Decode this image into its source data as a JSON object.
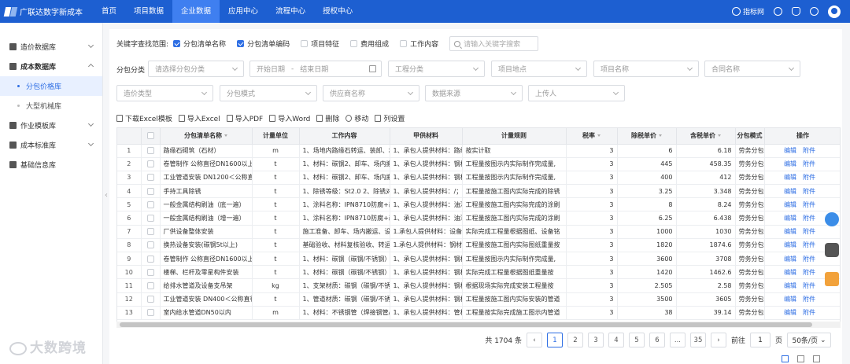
{
  "app": {
    "title": "广联达数字新成本"
  },
  "nav": [
    "首页",
    "项目数据",
    "企业数据",
    "应用中心",
    "流程中心",
    "授权中心"
  ],
  "nav_active_index": 2,
  "header_right": {
    "index_net": "指标网"
  },
  "sidebar": {
    "items": [
      {
        "label": "造价数据库"
      },
      {
        "label": "成本数据库"
      },
      {
        "label": "分包价格库"
      },
      {
        "label": "大型机械库"
      },
      {
        "label": "作业模板库"
      },
      {
        "label": "成本标准库"
      },
      {
        "label": "基础信息库"
      }
    ]
  },
  "keyword_filter": {
    "label": "关键字查找范围:",
    "options": [
      {
        "label": "分包清单名称",
        "checked": true
      },
      {
        "label": "分包清单编码",
        "checked": true
      },
      {
        "label": "项目特征",
        "checked": false
      },
      {
        "label": "费用组成",
        "checked": false
      },
      {
        "label": "工作内容",
        "checked": false
      }
    ],
    "search_placeholder": "请输入关键字搜索"
  },
  "filters": {
    "subcontract_label": "分包分类",
    "subcontract_placeholder": "请选择分包分类",
    "start_date": "开始日期",
    "date_sep": "-",
    "end_date": "结束日期",
    "work_type": "工程分类",
    "project_location": "项目地点",
    "project_name": "项目名称",
    "contract_name": "合同名称",
    "price_type": "造价类型",
    "sub_mode": "分包模式",
    "supplier": "供应商名称",
    "data_source": "数据来源",
    "uploader": "上传人"
  },
  "toolbar": {
    "download": "下载Excel模板",
    "import_excel": "导入Excel",
    "import_pdf": "导入PDF",
    "import_word": "导入Word",
    "delete": "删除",
    "move": "移动",
    "columns": "列设置"
  },
  "table": {
    "headers": [
      "分包清单名称",
      "计量单位",
      "工作内容",
      "甲供材料",
      "计量规则",
      "税率",
      "除税单价",
      "含税单价",
      "分包模式",
      "操作"
    ],
    "edit_label": "编辑",
    "attach_label": "附件",
    "rows": [
      {
        "idx": "1",
        "name": "路缘石砌筑（石材）",
        "unit": "m",
        "work": "1、场地内路缘石转运、装卸、堆",
        "material": "1、承包人提供材料：路缘石",
        "rule": "按实计取",
        "tax": "3",
        "ex": "6",
        "inc": "6.18",
        "mode": "劳务分包"
      },
      {
        "idx": "2",
        "name": "卷管制作 公称直径DN1600以上",
        "unit": "t",
        "work": "1、材料：碳钢2、卸车、场内搬",
        "material": "1、承包人提供材料：钢材、",
        "rule": "工程量按图示内实际制作完成量,",
        "tax": "3",
        "ex": "445",
        "inc": "458.35",
        "mode": "劳务分包"
      },
      {
        "idx": "3",
        "name": "工业管道安装 DN1200＜公称直径",
        "unit": "t",
        "work": "1、材料：碳钢2、卸车、场内搬",
        "material": "1、承包人提供材料：钢材、",
        "rule": "工程量按图示内实际制作完成量,",
        "tax": "3",
        "ex": "400",
        "inc": "412",
        "mode": "劳务分包"
      },
      {
        "idx": "4",
        "name": "手持工具除锈",
        "unit": "t",
        "work": "1、除锈等级：St2.0 2、除锈对象",
        "material": "1、承包人提供材料：/；承",
        "rule": "工程量按施工图内实际完成的除锈",
        "tax": "3",
        "ex": "3.25",
        "inc": "3.348",
        "mode": "劳务分包"
      },
      {
        "idx": "5",
        "name": "一般金属结构刷油（底一遍）",
        "unit": "t",
        "work": "1、涂料名称：IPN8710防腐+改性",
        "material": "1、承包人提供材料：油漆及",
        "rule": "工程量按施工图内实际完成的涂刷",
        "tax": "3",
        "ex": "8",
        "inc": "8.24",
        "mode": "劳务分包"
      },
      {
        "idx": "6",
        "name": "一般金属结构刷油（增一遍）",
        "unit": "t",
        "work": "1、涂料名称：IPN8710防腐+改性",
        "material": "1、承包人提供材料：油漆及",
        "rule": "工程量按施工图内实际完成的涂刷",
        "tax": "3",
        "ex": "6.25",
        "inc": "6.438",
        "mode": "劳务分包"
      },
      {
        "idx": "7",
        "name": "厂供设备整体安装",
        "unit": "t",
        "work": "施工准备、卸车、场内搬运、设备",
        "material": "1.承包人提供材料：设备、设",
        "rule": "实际完成工程量根据图纸、设备铭",
        "tax": "3",
        "ex": "1000",
        "inc": "1030",
        "mode": "劳务分包"
      },
      {
        "idx": "8",
        "name": "换热设备安装(碳钢5t以上)",
        "unit": "t",
        "work": "基础验收、材料复核验收、转运、",
        "material": "1.承包人提供材料：钢材、设",
        "rule": "工程量按施工图内实际图纸重量按",
        "tax": "3",
        "ex": "1820",
        "inc": "1874.6",
        "mode": "劳务分包"
      },
      {
        "idx": "9",
        "name": "卷管制作 公称直径DN1600以上",
        "unit": "t",
        "work": "1、材料：碳钢（碳钢/不锈钢）",
        "material": "1、承包人提供材料：钢材；",
        "rule": "工程量按图示内实际制作完成量,",
        "tax": "3",
        "ex": "3600",
        "inc": "3708",
        "mode": "劳务分包"
      },
      {
        "idx": "10",
        "name": "楼梯、栏杆及零星构件安装",
        "unit": "t",
        "work": "1、材料：碳钢（碳钢/不锈钢）",
        "material": "1、承包人提供材料：钢材；",
        "rule": "实际完成工程量根据图纸重量按",
        "tax": "3",
        "ex": "1420",
        "inc": "1462.6",
        "mode": "劳务分包"
      },
      {
        "idx": "11",
        "name": "给排水管道及设备支吊架",
        "unit": "kg",
        "work": "1、支架材质：碳钢（碳钢/不锈",
        "material": "1、承包人提供材料：钢材；",
        "rule": "根据现场实际完成安装工程量按",
        "tax": "3",
        "ex": "2.505",
        "inc": "2.58",
        "mode": "劳务分包"
      },
      {
        "idx": "12",
        "name": "工业管道安装 DN400＜公称直径",
        "unit": "t",
        "work": "1、管道材质：碳钢（碳钢/不锈",
        "material": "1、承包人提供材料：钢材；",
        "rule": "工程量按施工图内实际安装的管道",
        "tax": "3",
        "ex": "3500",
        "inc": "3605",
        "mode": "劳务分包"
      },
      {
        "idx": "13",
        "name": "室内给水管道DN50以内",
        "unit": "m",
        "work": "1、材料：不锈钢管（焊接钢管/E",
        "material": "1、承包人提供材料：管材、",
        "rule": "工程量按实际完成施工图示内管道",
        "tax": "3",
        "ex": "38",
        "inc": "39.14",
        "mode": "劳务分包"
      }
    ]
  },
  "pagination": {
    "total_text": "共 1704 条",
    "pages": [
      "1",
      "2",
      "3",
      "4",
      "5",
      "6",
      "...",
      "35"
    ],
    "current": "1",
    "goto_label": "前往",
    "goto_value": "1",
    "page_unit": "页",
    "page_size": "50条/页"
  },
  "watermark": "大数跨境",
  "colors": {
    "primary": "#1d5fd1",
    "accent": "#2f6fe4"
  }
}
